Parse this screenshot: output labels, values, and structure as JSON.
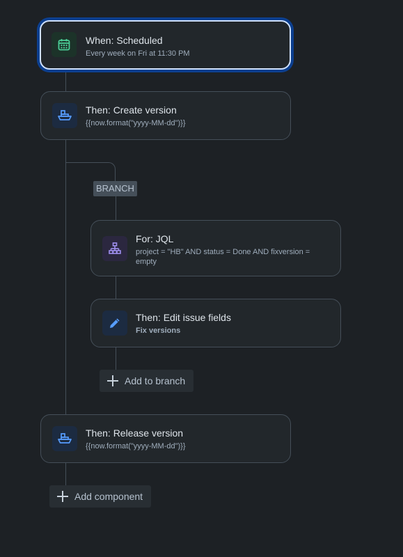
{
  "trigger": {
    "title": "When: Scheduled",
    "subtitle": "Every week on Fri at 11:30 PM",
    "icon": "calendar-icon"
  },
  "steps": [
    {
      "title": "Then: Create version",
      "subtitle": "{{now.format(\"yyyy-MM-dd\")}}",
      "icon": "ship-icon"
    },
    {
      "title": "Then: Release version",
      "subtitle": "{{now.format(\"yyyy-MM-dd\")}}",
      "icon": "ship-icon"
    }
  ],
  "branch": {
    "label": "BRANCH",
    "items": [
      {
        "title": "For: JQL",
        "subtitle": "project = \"HB\" AND status = Done AND fixversion = empty",
        "icon": "hierarchy-icon"
      },
      {
        "title": "Then: Edit issue fields",
        "subtitle": "Fix versions",
        "icon": "pencil-icon"
      }
    ],
    "add_label": "Add to branch"
  },
  "add_component_label": "Add component",
  "colors": {
    "background": "#1d2125",
    "card": "#22272b",
    "selected_border": "#cfe1fd",
    "selected_glow": "#0c3f8f",
    "green_icon": "#4bce97",
    "blue_icon": "#579dff",
    "purple_icon": "#9f8fef"
  }
}
